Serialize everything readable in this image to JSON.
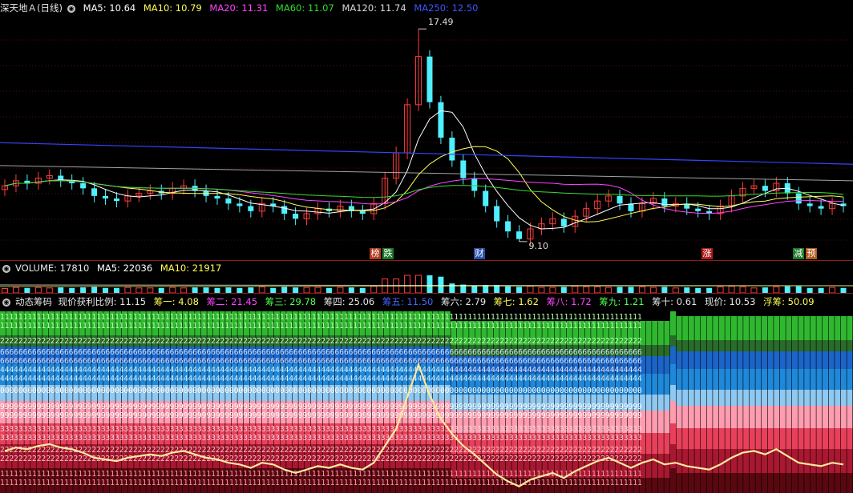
{
  "price_header": {
    "title": "深天地Ａ(日线)",
    "ma5_label": "MA5: 10.64",
    "ma10_label": "MA10: 10.79",
    "ma20_label": "MA20: 11.31",
    "ma60_label": "MA60: 11.07",
    "ma120_label": "MA120: 11.74",
    "ma250_label": "MA250: 12.50"
  },
  "price_annotations": {
    "high_label": "17.49",
    "low_label": "9.10"
  },
  "event_markers": [
    {
      "text": "榜",
      "color": "#b03a1c"
    },
    {
      "text": "跌",
      "color": "#1c7a2a"
    },
    {
      "text": "财",
      "color": "#2a4fa8"
    },
    {
      "text": "涨",
      "color": "#b01c1c"
    },
    {
      "text": "减",
      "color": "#1c7a2a"
    },
    {
      "text": "预",
      "color": "#b05a1c"
    }
  ],
  "volume_header": {
    "title": "VOLUME: 17810",
    "ma5_label": "MA5: 22036",
    "ma10_label": "MA10: 21917"
  },
  "chip_header": {
    "title": "动态筹码",
    "profit_ratio": "现价获利比例: 11.15",
    "chip1": "筹一: 4.08",
    "chip2": "筹二: 21.45",
    "chip3": "筹三: 29.78",
    "chip4": "筹四: 25.06",
    "chip5": "筹五: 11.50",
    "chip6": "筹六: 2.79",
    "chip7": "筹七: 1.62",
    "chip8": "筹八: 1.72",
    "chip9": "筹九: 1.21",
    "chip10": "筹十: 0.61",
    "current_price": "现价: 10.53",
    "floating_chips": "浮筹: 50.09"
  },
  "colors": {
    "up": "#ff3c3c",
    "down": "#4ff0ff",
    "ma5": "#ffffff",
    "ma10": "#ffff55",
    "ma20": "#ff44ff",
    "ma60": "#33dd33",
    "ma120": "#cccccc",
    "ma250": "#3344ff",
    "separator": "#8a1c1c",
    "profit_line": "#ffe9a0"
  },
  "chart_data": {
    "type": "candlestick",
    "close_series": [
      11.3,
      11.5,
      11.4,
      11.6,
      11.7,
      11.5,
      11.4,
      11.2,
      10.9,
      10.8,
      10.7,
      10.9,
      11.0,
      11.1,
      11.0,
      11.2,
      11.3,
      11.1,
      10.9,
      10.8,
      10.6,
      10.5,
      10.3,
      10.6,
      10.5,
      10.2,
      10.0,
      10.2,
      10.4,
      10.3,
      10.5,
      10.3,
      10.2,
      10.6,
      11.6,
      12.6,
      14.5,
      16.4,
      14.6,
      13.2,
      12.3,
      11.6,
      11.1,
      10.5,
      9.9,
      9.5,
      9.2,
      9.6,
      9.8,
      10.0,
      9.7,
      10.1,
      10.4,
      10.7,
      10.9,
      10.6,
      10.3,
      10.6,
      10.8,
      10.5,
      10.6,
      10.4,
      10.3,
      10.2,
      10.5,
      10.9,
      11.2,
      11.3,
      11.1,
      11.4,
      11.0,
      10.6,
      10.5,
      10.4,
      10.6,
      10.5
    ],
    "high": "17.49",
    "low": "9.10",
    "ma_values": {
      "MA5": 10.64,
      "MA10": 10.79,
      "MA20": 11.31,
      "MA60": 11.07,
      "MA120": 11.74,
      "MA250": 12.5
    }
  }
}
